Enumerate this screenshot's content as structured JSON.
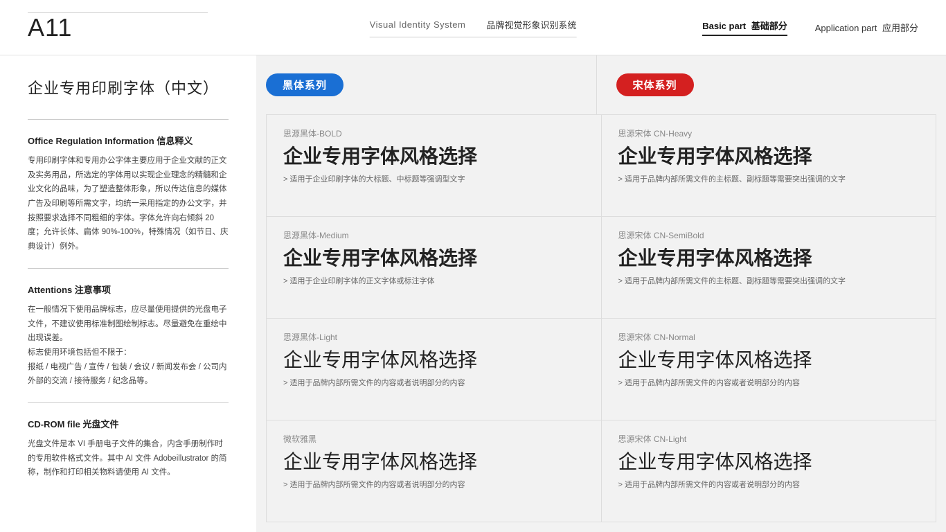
{
  "header": {
    "page_id": "A11",
    "divider_shown": true,
    "vi_label": "Visual Identity System",
    "vi_cn_label": "品牌视觉形象识别系统",
    "nav_items": [
      {
        "label": "Basic part",
        "label_cn": "基础部分",
        "active": true
      },
      {
        "label": "Application part",
        "label_cn": "应用部分",
        "active": false
      }
    ]
  },
  "sidebar": {
    "title": "企业专用印刷字体（中文）",
    "sections": [
      {
        "title": "Office Regulation Information 信息释义",
        "body": "专用印刷字体和专用办公字体主要应用于企业文献的正文及实务用品，所选定的字体用以实现企业理念的精髓和企业文化的品味，为了塑造整体形象，所以传达信息的媒体广告及印刷等所需文字，均统一采用指定的办公文字，并按照要求选择不同粗细的字体。字体允许向右倾斜 20 度；允许长体、扁体 90%-100%，特殊情况（如节日、庆典设计）例外。"
      },
      {
        "title": "Attentions 注意事项",
        "body": "在一般情况下使用品牌标志，应尽量使用提供的光盘电子文件，不建议使用标准制图绘制标志。尽量避免在重绘中出现误差。\n标志使用环境包括但不限于：\n报纸 / 电视广告 / 宣传 / 包装 / 会议 / 新闻发布会 / 公司内外部的交流 / 接待服务 / 纪念品等。"
      },
      {
        "title": "CD-ROM file 光盘文件",
        "body": "光盘文件是本 VI 手册电子文件的集合，内含手册制作时的专用软件格式文件。其中 AI 文件 Adobeillustrator 的简称，制作和打印相关物料请使用 AI 文件。"
      }
    ]
  },
  "content": {
    "left_header": "黑体系列",
    "right_header": "宋体系列",
    "left_color": "#1a6fd4",
    "right_color": "#d42020",
    "font_rows": [
      {
        "left": {
          "font_name": "思源黑体-BOLD",
          "demo_text": "企业专用字体风格选择",
          "weight": "bold",
          "desc": "> 适用于企业印刷字体的大标题、中标题等强调型文字"
        },
        "right": {
          "font_name": "思源宋体 CN-Heavy",
          "demo_text": "企业专用字体风格选择",
          "weight": "bold",
          "desc": "> 适用于品牌内部所需文件的主标题、副标题等需要突出强调的文字"
        }
      },
      {
        "left": {
          "font_name": "思源黑体-Medium",
          "demo_text": "企业专用字体风格选择",
          "weight": "medium",
          "desc": "> 适用于企业印刷字体的正文字体或标注字体"
        },
        "right": {
          "font_name": "思源宋体 CN-SemiBold",
          "demo_text": "企业专用字体风格选择",
          "weight": "medium",
          "desc": "> 适用于品牌内部所需文件的主标题、副标题等需要突出强调的文字"
        }
      },
      {
        "left": {
          "font_name": "思源黑体-Light",
          "demo_text": "企业专用字体风格选择",
          "weight": "light",
          "desc": "> 适用于品牌内部所需文件的内容或者说明部分的内容"
        },
        "right": {
          "font_name": "思源宋体 CN-Normal",
          "demo_text": "企业专用字体风格选择",
          "weight": "light",
          "desc": "> 适用于品牌内部所需文件的内容或者说明部分的内容"
        }
      },
      {
        "left": {
          "font_name": "微软雅黑",
          "demo_text": "企业专用字体风格选择",
          "weight": "light",
          "desc": "> 适用于品牌内部所需文件的内容或者说明部分的内容"
        },
        "right": {
          "font_name": "思源宋体 CN-Light",
          "demo_text": "企业专用字体风格选择",
          "weight": "light",
          "desc": "> 适用于品牌内部所需文件的内容或者说明部分的内容"
        }
      }
    ]
  }
}
